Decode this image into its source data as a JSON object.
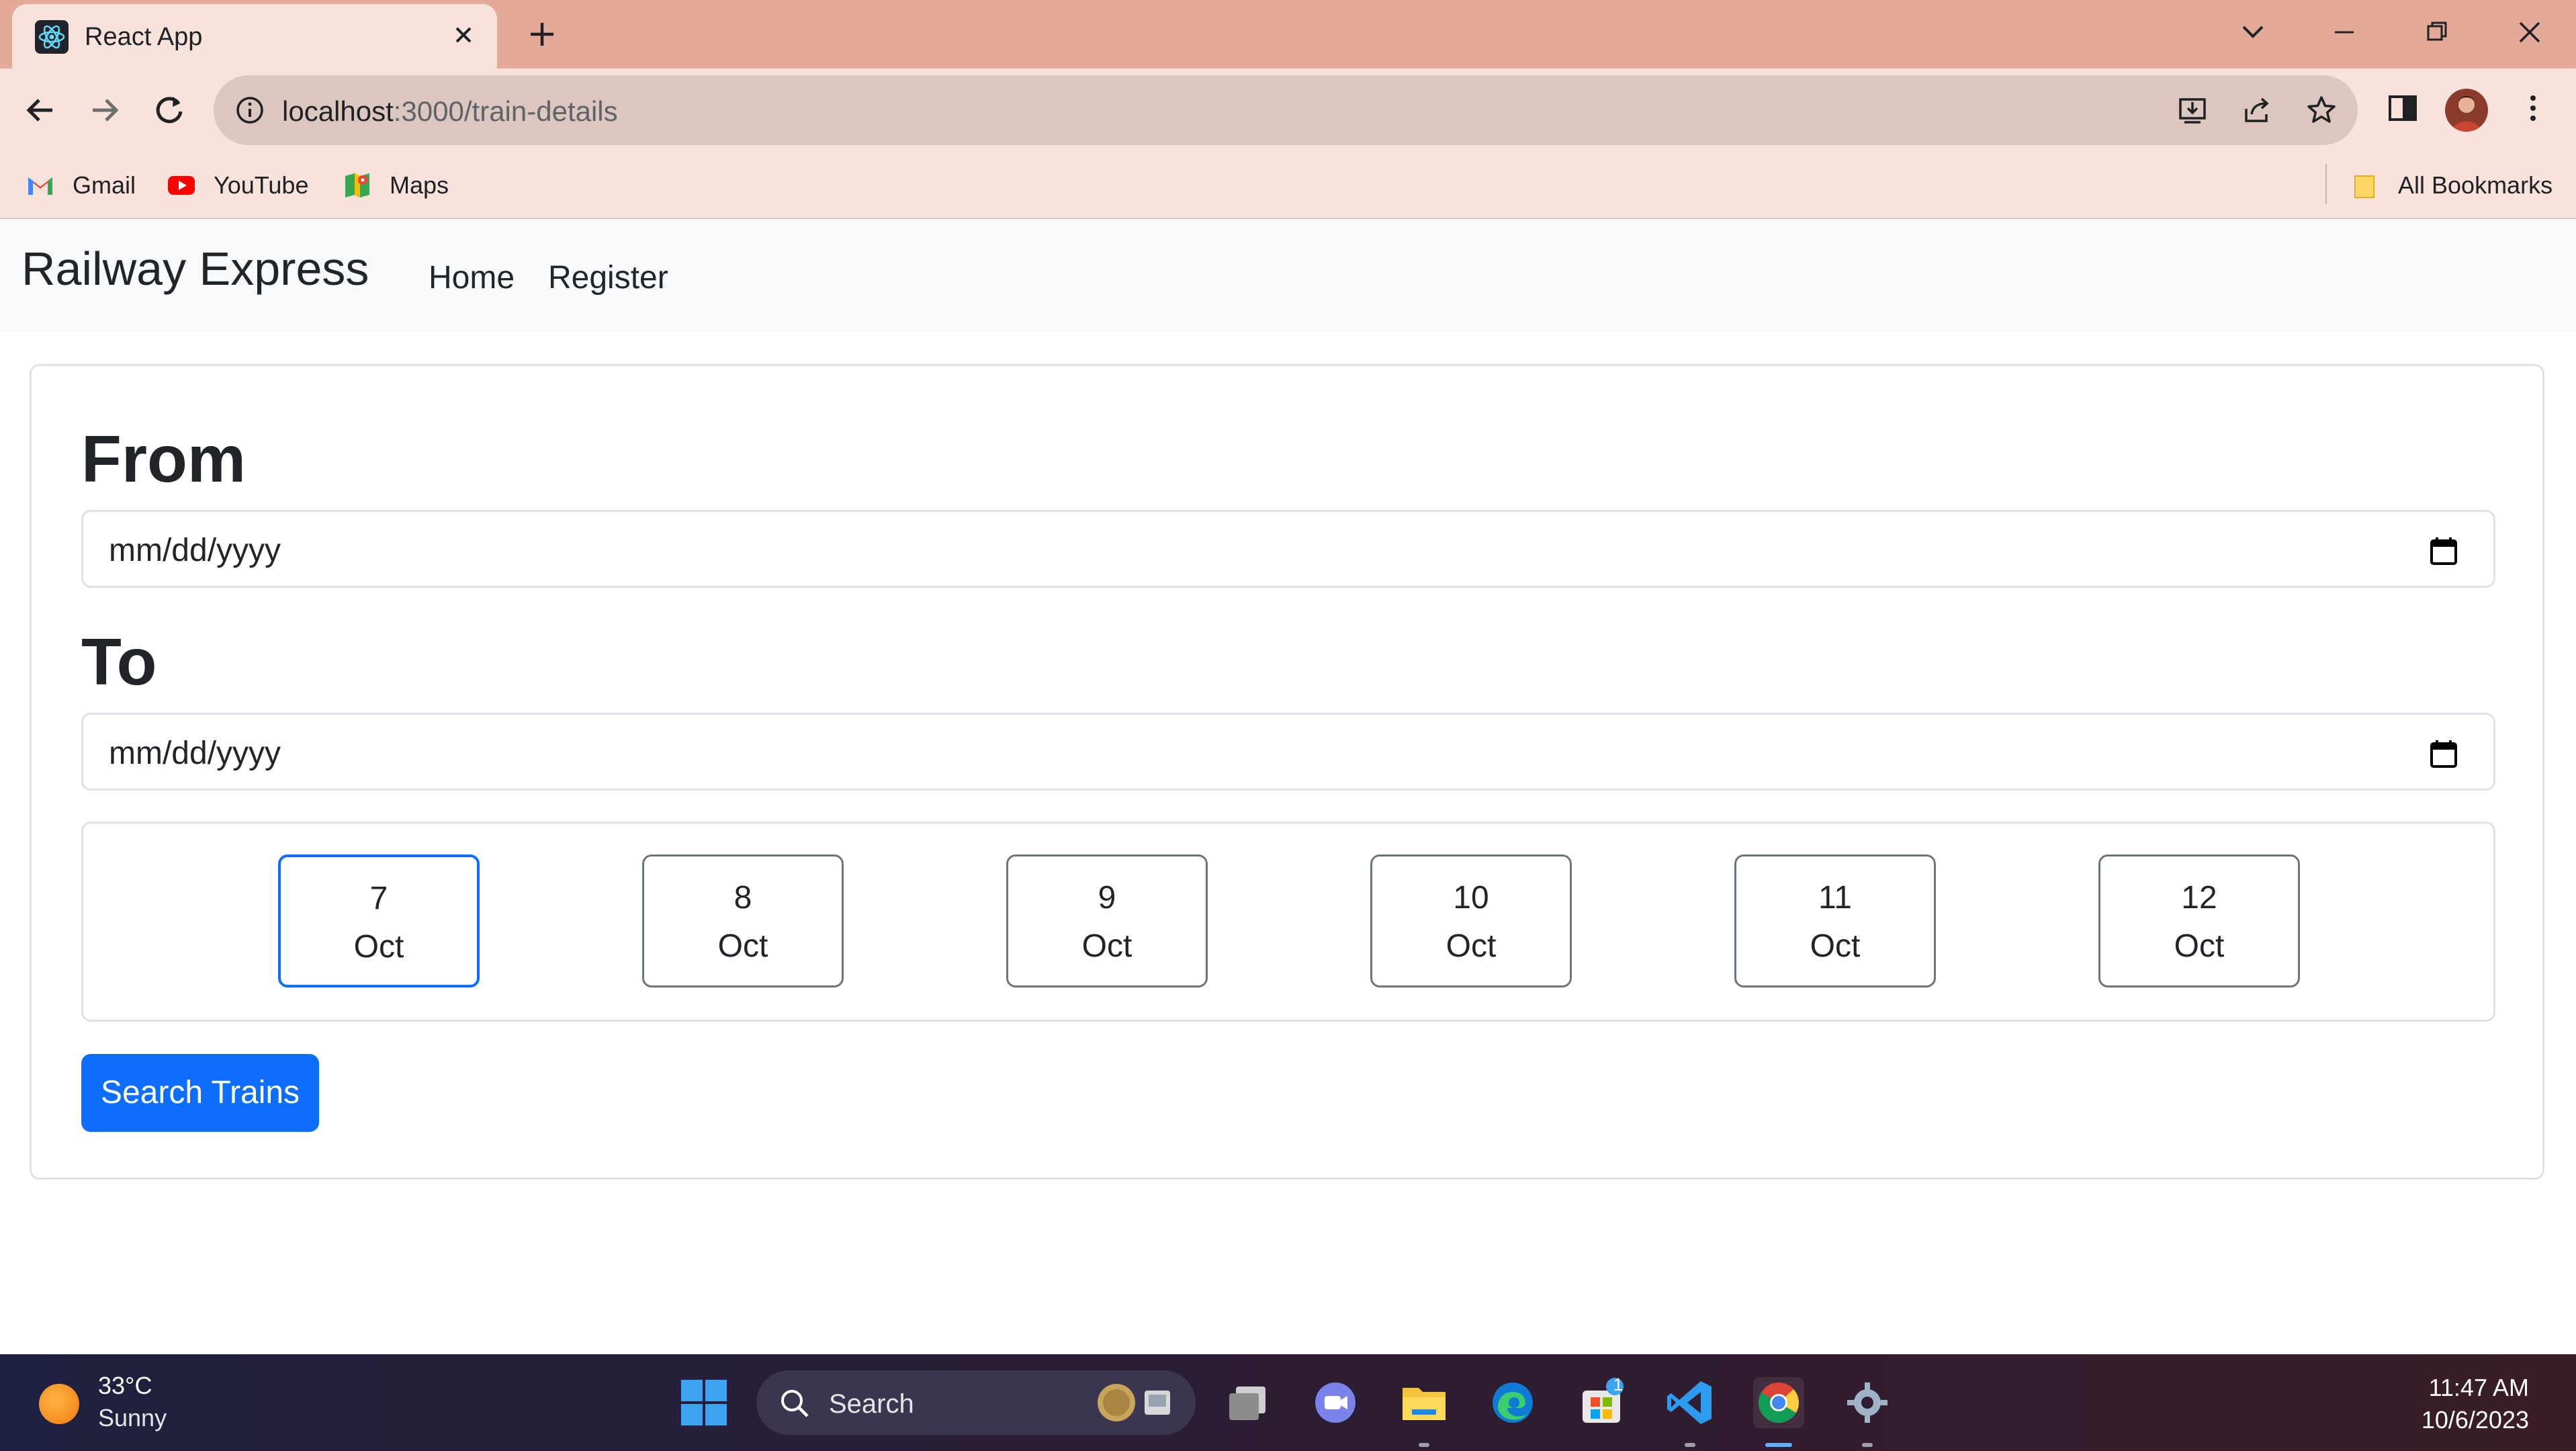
{
  "browser": {
    "tab_title": "React App",
    "url_host": "localhost",
    "url_path": ":3000/train-details",
    "bookmarks": [
      {
        "label": "Gmail",
        "icon": "gmail-icon"
      },
      {
        "label": "YouTube",
        "icon": "youtube-icon"
      },
      {
        "label": "Maps",
        "icon": "maps-icon"
      }
    ],
    "all_bookmarks": "All Bookmarks"
  },
  "app": {
    "brand": "Railway Express",
    "nav": [
      "Home",
      "Register"
    ],
    "from_label": "From",
    "to_label": "To",
    "from_placeholder": "mm/dd/yyyy",
    "to_placeholder": "mm/dd/yyyy",
    "days": [
      {
        "day": "7",
        "month": "Oct",
        "selected": true
      },
      {
        "day": "8",
        "month": "Oct",
        "selected": false
      },
      {
        "day": "9",
        "month": "Oct",
        "selected": false
      },
      {
        "day": "10",
        "month": "Oct",
        "selected": false
      },
      {
        "day": "11",
        "month": "Oct",
        "selected": false
      },
      {
        "day": "12",
        "month": "Oct",
        "selected": false
      }
    ],
    "search_button": "Search Trains",
    "colors": {
      "primary": "#0d6efd",
      "border": "#dee2e6",
      "navbar": "#f8f9fa"
    }
  },
  "taskbar": {
    "weather_temp": "33°C",
    "weather_desc": "Sunny",
    "search_placeholder": "Search",
    "time": "11:47 AM",
    "date": "10/6/2023",
    "store_badge": "1"
  }
}
